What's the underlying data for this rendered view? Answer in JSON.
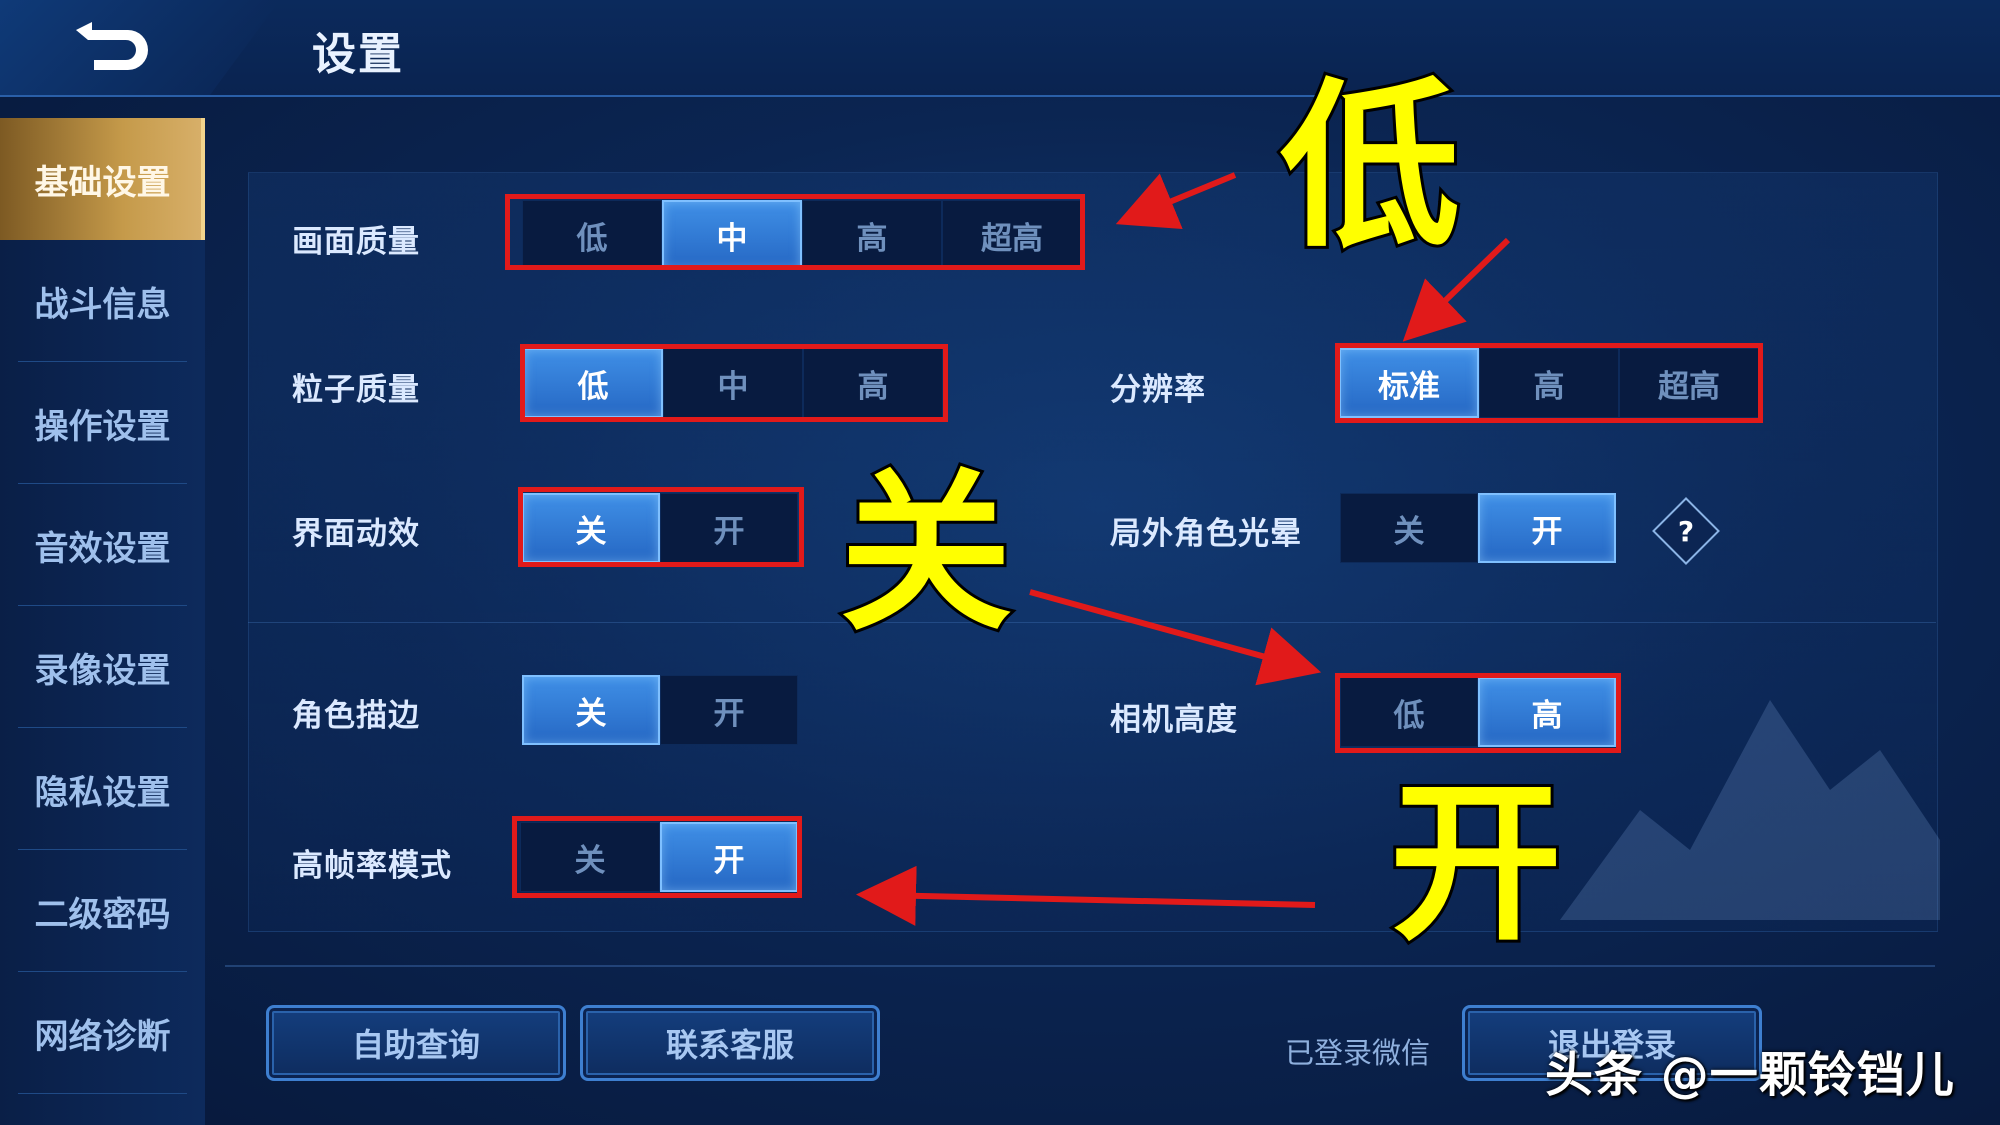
{
  "header": {
    "title": "设置"
  },
  "sidebar": {
    "items": [
      {
        "label": "基础设置"
      },
      {
        "label": "战斗信息"
      },
      {
        "label": "操作设置"
      },
      {
        "label": "音效设置"
      },
      {
        "label": "录像设置"
      },
      {
        "label": "隐私设置"
      },
      {
        "label": "二级密码"
      },
      {
        "label": "网络诊断"
      }
    ]
  },
  "settings": {
    "graphics_quality": {
      "label": "画面质量",
      "options": [
        "低",
        "中",
        "高",
        "超高"
      ],
      "selected": "中"
    },
    "particle_quality": {
      "label": "粒子质量",
      "options": [
        "低",
        "中",
        "高"
      ],
      "selected": "低"
    },
    "resolution": {
      "label": "分辨率",
      "options": [
        "标准",
        "高",
        "超高"
      ],
      "selected": "标准"
    },
    "ui_animation": {
      "label": "界面动效",
      "options": [
        "关",
        "开"
      ],
      "selected": "关"
    },
    "outgame_halo": {
      "label": "局外角色光晕",
      "options": [
        "关",
        "开"
      ],
      "selected": "开",
      "help": "?"
    },
    "hero_outline": {
      "label": "角色描边",
      "options": [
        "关",
        "开"
      ],
      "selected": "关"
    },
    "camera_height": {
      "label": "相机高度",
      "options": [
        "低",
        "高"
      ],
      "selected": "高"
    },
    "high_fps": {
      "label": "高帧率模式",
      "options": [
        "关",
        "开"
      ],
      "selected": "开"
    }
  },
  "footer": {
    "self_help": "自助查询",
    "contact": "联系客服",
    "login_status": "已登录微信",
    "logout": "退出登录"
  },
  "annotations": {
    "low": "低",
    "off": "关",
    "on": "开"
  },
  "watermark": "头条 @一颗铃铛儿",
  "colors": {
    "highlight_box": "#e11a1a",
    "annotation_text": "#ffff00",
    "selected_option": "#2f7bd6",
    "active_tab": "#c59a4a"
  }
}
